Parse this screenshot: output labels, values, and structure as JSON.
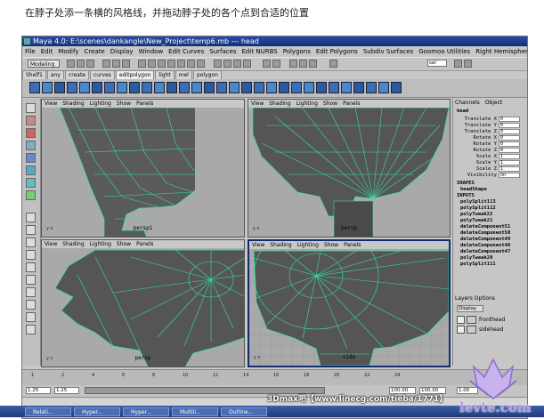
{
  "caption": "在脖子处添一条横的风格线，并拖动脖子处的各个点到合适的位置",
  "window": {
    "title": "Maya 4.0: E:\\scenes\\dankangle\\New_Project\\temp6.mb  ---  head"
  },
  "menus": [
    "File",
    "Edit",
    "Modify",
    "Create",
    "Display",
    "Window",
    "Edit Curves",
    "Surfaces",
    "Edit NURBS",
    "Polygons",
    "Edit Polygons",
    "Subdiv Surfaces",
    "Goomoo Utilities",
    "Right Hemisphere",
    "Help"
  ],
  "status": {
    "mode": "Modeling",
    "sel_field": "sel"
  },
  "shelf_tabs": [
    "Shelf1",
    "any",
    "create",
    "curves",
    "editpolygon",
    "light",
    "mel",
    "polygon"
  ],
  "viewport_menu": [
    "View",
    "Shading",
    "Lighting",
    "Show",
    "Panels"
  ],
  "viewports": [
    {
      "label": "persp1",
      "axis": "y x"
    },
    {
      "label": "persp",
      "axis": "y x"
    },
    {
      "label": "persp",
      "axis": "y z"
    },
    {
      "label": "side",
      "axis": "y z"
    }
  ],
  "channel_box": {
    "tabs": [
      "Channels",
      "Object"
    ],
    "object": "head",
    "attributes": [
      {
        "name": "Translate X",
        "value": "0"
      },
      {
        "name": "Translate Y",
        "value": "0"
      },
      {
        "name": "Translate Z",
        "value": "0"
      },
      {
        "name": "Rotate X",
        "value": "0"
      },
      {
        "name": "Rotate Y",
        "value": "0"
      },
      {
        "name": "Rotate Z",
        "value": "0"
      },
      {
        "name": "Scale X",
        "value": "1"
      },
      {
        "name": "Scale Y",
        "value": "1"
      },
      {
        "name": "Scale Z",
        "value": "1"
      },
      {
        "name": "Visibility",
        "value": "on"
      }
    ],
    "shapes_header": "SHAPES",
    "shape": "headShape",
    "inputs_header": "INPUTS",
    "inputs": [
      "polySplit113",
      "polySplit112",
      "polyTweak22",
      "polyTweak21",
      "deleteComponent51",
      "deleteComponent50",
      "deleteComponent49",
      "deleteComponent48",
      "deleteComponent47",
      "polyTweak20",
      "polySplit111"
    ]
  },
  "layers": {
    "tabs": [
      "Layers",
      "Options"
    ],
    "mode": "Display",
    "items": [
      "fronthead",
      "sidehead"
    ]
  },
  "timeline_ticks": [
    "1",
    "2",
    "4",
    "6",
    "8",
    "10",
    "12",
    "14",
    "16",
    "18",
    "20",
    "22",
    "24"
  ],
  "range": {
    "start": "1.25",
    "start2": "1.25",
    "end": "100.00",
    "end2": "100.00",
    "current": "1.00"
  },
  "taskbar": [
    "Relati...",
    "Hyper...",
    "Hyper...",
    "Multili...",
    "Outline..."
  ],
  "watermark": "3Dmax吧【www.linecg.com/tieba/1771】",
  "logo_text": "levte.com",
  "colors": {
    "wire": "#33e0a8",
    "mesh": "#555555",
    "viewport_bg": "#a9a9a9",
    "title_bar": "#1e3a8a"
  }
}
